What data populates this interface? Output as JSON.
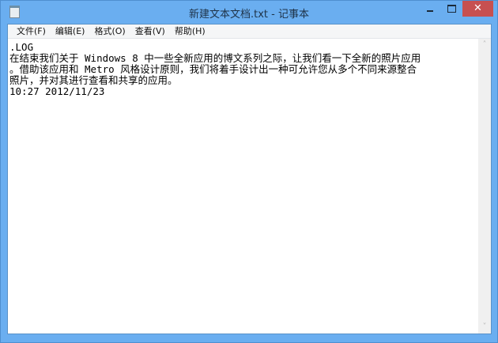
{
  "window": {
    "title": "新建文本文档.txt - 记事本",
    "close_glyph": "✕",
    "accent": "#6aaef0",
    "close_color": "#c75050"
  },
  "menu": [
    "文件(F)",
    "编辑(E)",
    "格式(O)",
    "查看(V)",
    "帮助(H)"
  ],
  "editor": {
    "lines": [
      ".LOG",
      "在结束我们关于 Windows 8 中一些全新应用的博文系列之际，让我们看一下全新的照片应用",
      "。借助该应用和 Metro 风格设计原则，我们将着手设计出一种可允许您从多个不同来源整合",
      "照片，并对其进行查看和共享的应用。",
      "10:27 2012/11/23"
    ]
  },
  "scrollbar": {
    "up": "˄",
    "down": "˅"
  }
}
